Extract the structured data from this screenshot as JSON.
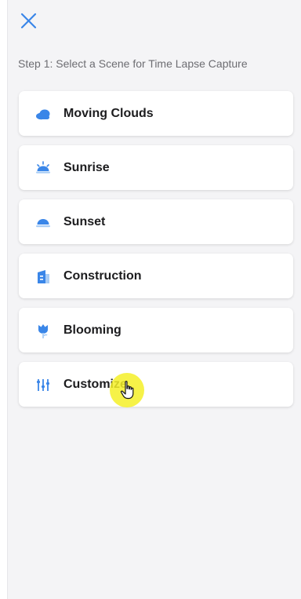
{
  "header": {
    "close_icon": "close-x-icon",
    "step_text": "Step 1: Select a Scene for Time Lapse Capture"
  },
  "scenes": [
    {
      "label": "Moving Clouds",
      "icon": "cloud-icon"
    },
    {
      "label": "Sunrise",
      "icon": "sunrise-icon"
    },
    {
      "label": "Sunset",
      "icon": "sunset-icon"
    },
    {
      "label": "Construction",
      "icon": "building-icon"
    },
    {
      "label": "Blooming",
      "icon": "flower-icon"
    },
    {
      "label": "Customize",
      "icon": "sliders-icon"
    }
  ],
  "colors": {
    "accent": "#3a86e8",
    "background": "#f4f4f6",
    "card": "#ffffff",
    "text": "#1c1c1e",
    "secondary_text": "#6d6d72",
    "cursor_highlight": "#f5f028"
  },
  "cursor": {
    "icon": "hand-pointer-icon"
  }
}
